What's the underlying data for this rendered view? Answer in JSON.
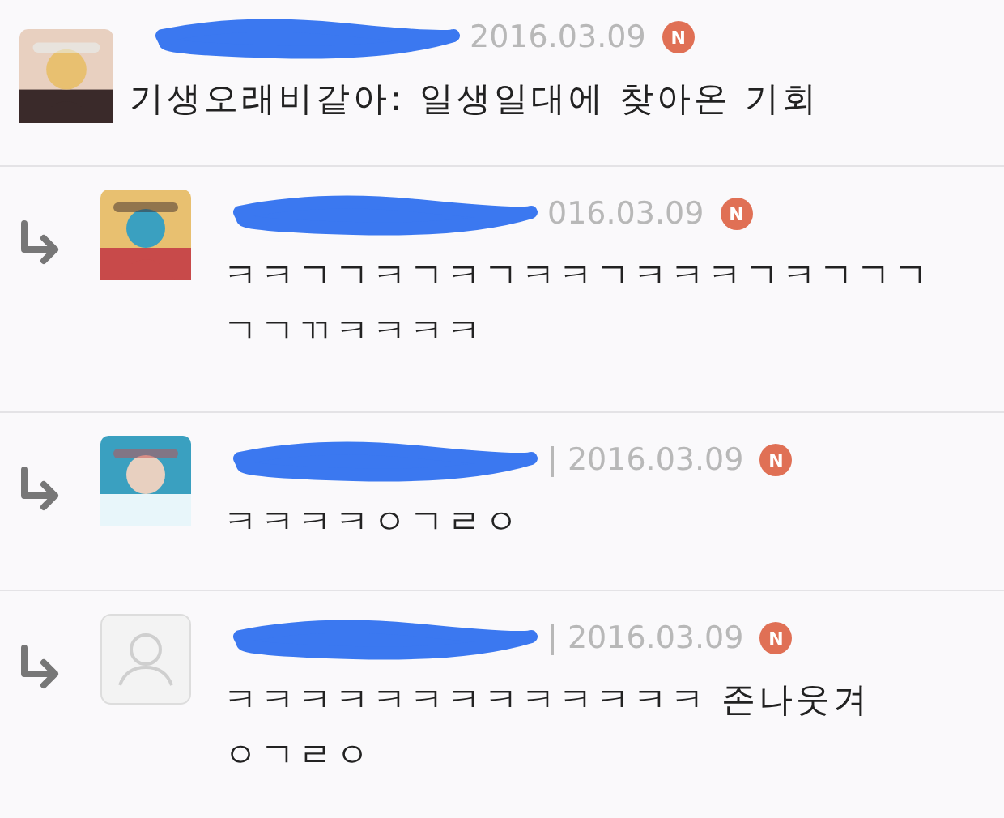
{
  "comments": [
    {
      "reply": false,
      "avatar": {
        "kind": "picture"
      },
      "date": "2016.03.09",
      "new": true,
      "new_badge": "N",
      "lines": [
        "기생오래비같아: 일생일대에 찾아온 기회"
      ]
    },
    {
      "reply": true,
      "avatar": {
        "kind": "picture"
      },
      "date": "016.03.09",
      "new": true,
      "new_badge": "N",
      "lines": [
        "ㅋㅋㄱㄱㅋㄱㅋㄱㅋㅋㄱㅋㅋㅋㄱㅋㄱㄱㄱ",
        "ㄱㄱㄲㅋㅋㅋㅋ"
      ]
    },
    {
      "reply": true,
      "avatar": {
        "kind": "picture"
      },
      "date": "| 2016.03.09",
      "new": true,
      "new_badge": "N",
      "lines": [
        "ㅋㅋㅋㅋㅇㄱㄹㅇ"
      ]
    },
    {
      "reply": true,
      "avatar": {
        "kind": "default"
      },
      "date": "| 2016.03.09",
      "new": true,
      "new_badge": "N",
      "lines": [
        "ㅋㅋㅋㅋㅋㅋㅋㅋㅋㅋㅋㅋㅋ 존나웃겨",
        "ㅇㄱㄹㅇ"
      ]
    }
  ]
}
